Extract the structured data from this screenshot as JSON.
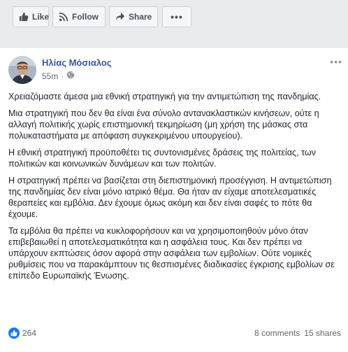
{
  "toolbar": {
    "like_label": "Like",
    "follow_label": "Follow",
    "share_label": "Share"
  },
  "post": {
    "author": "Ηλίας Μόσιαλος",
    "time": "55m",
    "privacy_icon": "globe-icon",
    "paragraphs": [
      "Χρειαζόμαστε άμεσα μια εθνική στρατηγική για την αντιμετώπιση της πανδημίας.",
      "Μια στρατηγική που δεν θα είναι ένα σύνολο αντανακλαστικών κινήσεων, ούτε η αλλαγή πολιτικής χωρίς επιστημονική τεκμηρίωση (μη χρήση της μάσκας στα πολυκαταστήματα με απόφαση συγκεκριμένου υπουργείου).",
      "Η εθνική στρατηγική προϋποθέτει τις συντονισμένες δράσεις της πολιτείας, των πολιτικών και κοινωνικών δυνάμεων και των πολιτών.",
      "Η στρατηγική πρέπει να βασίζεται στη διεπιστημονική προσέγγιση. Η αντιμετώπιση της πανδημίας δεν είναι μόνο ιατρικό θέμα. Θα ήταν αν είχαμε αποτελεσματικές θεραπείες και εμβόλια. Δεν έχουμε όμως ακόμη και δεν είναι σαφές το πότε θα έχουμε.",
      "Τα εμβόλια θα πρέπει να κυκλοφορήσουν και να χρησιμοποιηθούν μόνο όταν επιβεβαιωθεί η αποτελεσματικότητα και η ασφάλεια τους. Και δεν πρέπει να υπάρχουν εκπτώσεις όσον αφορά στην ασφάλεια των εμβολίων. Ούτε νομικές ρυθμίσεις που να παρακάμπτουν τις θεσπισμένες διαδικασίες έγκρισης εμβολίων σε επίπεδο Ευρωπαϊκής Ένωσης."
    ],
    "reactions_count": "264",
    "comments": "8 comments",
    "shares": "15 shares"
  },
  "colors": {
    "link_blue": "#385898",
    "like_blue": "#1877f2",
    "background": "#e9ebee"
  }
}
